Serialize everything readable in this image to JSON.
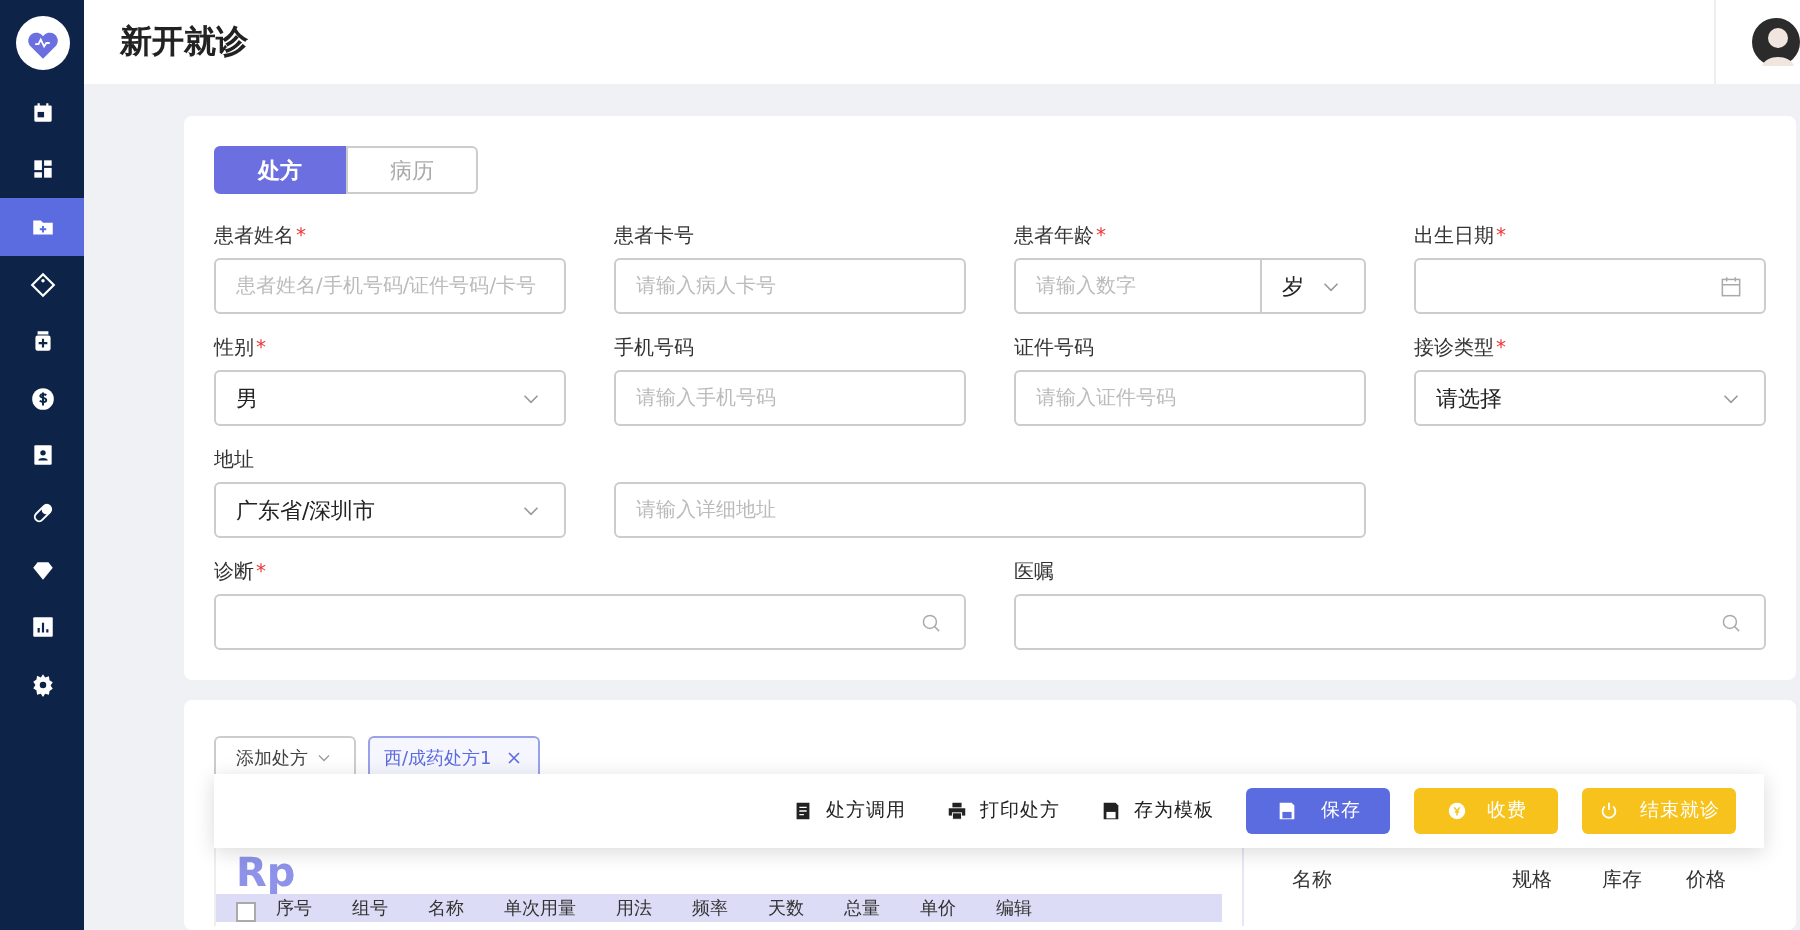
{
  "sidebar": {
    "items": [
      {
        "selected": false
      },
      {
        "selected": false
      },
      {
        "selected": true
      },
      {
        "selected": false
      },
      {
        "selected": false
      },
      {
        "selected": false
      },
      {
        "selected": false
      },
      {
        "selected": false
      },
      {
        "selected": false
      },
      {
        "selected": false
      },
      {
        "selected": false
      }
    ]
  },
  "header": {
    "title": "新开就诊"
  },
  "record_tabs": [
    {
      "label": "处方",
      "selected": true
    },
    {
      "label": "病历",
      "selected": false
    }
  ],
  "form": {
    "fields": [
      {
        "label": "患者姓名",
        "required_mark": "*",
        "kind": "text",
        "placeholder": "患者姓名/手机号码/证件号码/卡号"
      },
      {
        "label": "患者卡号",
        "kind": "text",
        "placeholder": "请输入病人卡号"
      },
      {
        "label": "患者年龄",
        "required_mark": "*",
        "kind": "age",
        "placeholder": "请输入数字",
        "unit": "岁"
      },
      {
        "label": "出生日期",
        "required_mark": "*",
        "kind": "date"
      },
      {
        "label": "性别",
        "required_mark": "*",
        "kind": "select",
        "value": "男"
      },
      {
        "label": "手机号码",
        "kind": "text",
        "placeholder": "请输入手机号码"
      },
      {
        "label": "证件号码",
        "kind": "text",
        "placeholder": "请输入证件号码"
      },
      {
        "label": "接诊类型",
        "required_mark": "*",
        "kind": "select",
        "value": "请选择"
      },
      {
        "label": "地址",
        "kind": "select",
        "value": "广东省/深圳市"
      },
      {
        "kind": "wide",
        "placeholder": "请输入详细地址"
      },
      {
        "label": "诊断",
        "required_mark": "*",
        "kind": "search"
      },
      {
        "label": "医嘱",
        "kind": "search"
      }
    ]
  },
  "prescriptions": {
    "add_button": "添加处方",
    "tabs": [
      {
        "label": "西/成药处方1",
        "selected": true
      }
    ]
  },
  "toolbar": {
    "actions": [
      {
        "label": "处方调用",
        "kind": "plain"
      },
      {
        "label": "打印处方",
        "kind": "plain"
      },
      {
        "label": "存为模板",
        "kind": "plain"
      },
      {
        "label": "保存",
        "kind": "primary"
      },
      {
        "label": "收费",
        "kind": "warning"
      },
      {
        "label": "结束就诊",
        "kind": "warning"
      }
    ]
  },
  "rx_panel": {
    "title": "Rp",
    "select_all_checked": false,
    "columns": [
      "序号",
      "组号",
      "名称",
      "单次用量",
      "用法",
      "频率",
      "天数",
      "总量",
      "单价",
      "编辑"
    ]
  },
  "drug_table": {
    "columns": [
      "名称",
      "规格",
      "库存",
      "价格"
    ]
  }
}
